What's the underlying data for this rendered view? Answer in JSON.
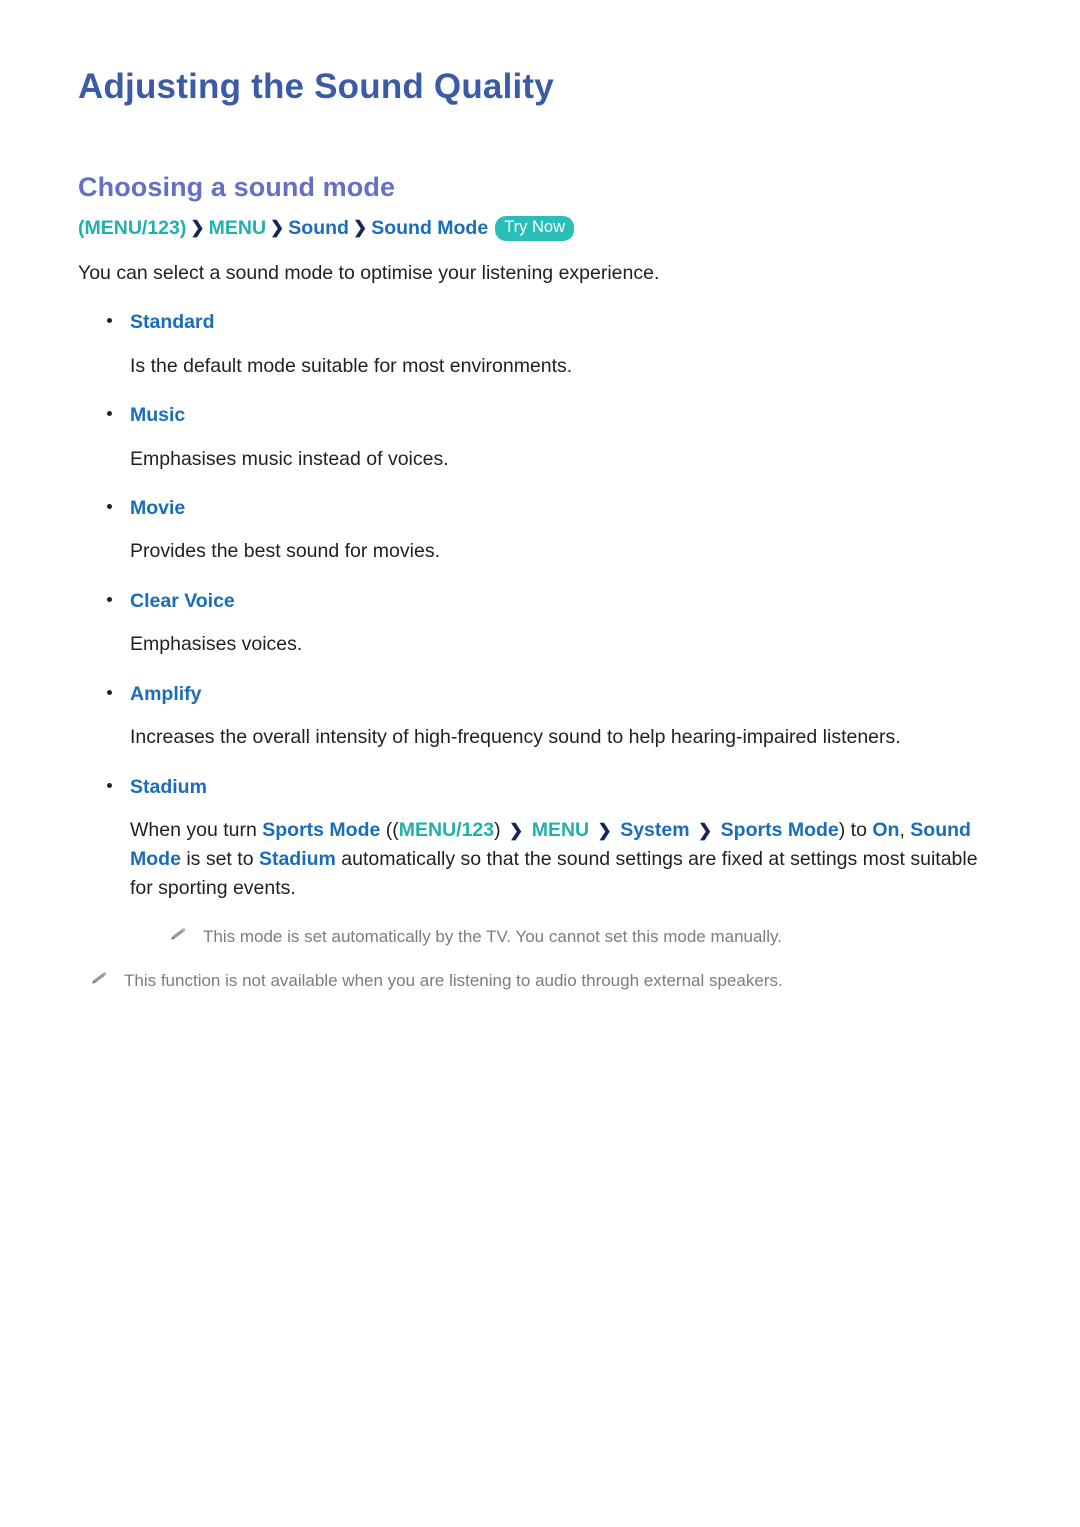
{
  "document": {
    "title": "Adjusting the Sound Quality",
    "section_heading": "Choosing a sound mode"
  },
  "breadcrumb": {
    "open_paren": "(",
    "menu123": "MENU/123",
    "close_paren": ")",
    "arrow": "❯",
    "menu": "MENU",
    "sound": "Sound",
    "sound_mode": "Sound Mode",
    "try_now_badge": "Try Now"
  },
  "intro": "You can select a sound mode to optimise your listening experience.",
  "modes": [
    {
      "label": "Standard",
      "description": "Is the default mode suitable for most environments."
    },
    {
      "label": "Music",
      "description": "Emphasises music instead of voices."
    },
    {
      "label": "Movie",
      "description": "Provides the best sound for movies."
    },
    {
      "label": "Clear Voice",
      "description": "Emphasises voices."
    },
    {
      "label": "Amplify",
      "description": "Increases the overall intensity of high-frequency sound to help hearing-impaired listeners."
    },
    {
      "label": "Stadium",
      "description_parts": {
        "t1": "When you turn ",
        "link1": "Sports Mode",
        "t2": " ((",
        "teal1": "MENU/123",
        "t3": ") ",
        "arrow1": "❯",
        "teal2": " MENU ",
        "arrow2": "❯",
        "link2": " System ",
        "arrow3": "❯",
        "link3": " Sports Mode",
        "t4": ") to ",
        "link4": "On",
        "t5": ", ",
        "link5": "Sound Mode",
        "t6": " is set to ",
        "link6": "Stadium",
        "t7": " automatically so that the sound settings are fixed at settings most suitable for sporting events."
      }
    }
  ],
  "notes": [
    "This mode is set automatically by the TV. You cannot set this mode manually.",
    "This function is not available when you are listening to audio through external speakers."
  ],
  "icons": {
    "pencil": "pencil-icon",
    "bullet": "bullet-dot-icon",
    "arrow": "chevron-right-icon"
  },
  "colors": {
    "title_blue": "#3c5ba6",
    "heading_purple": "#6470c4",
    "link_blue": "#1a6db8",
    "teal": "#22b0ad",
    "badge_teal": "#2bbdb7",
    "arrow_navy": "#15255c",
    "body_text": "#231f20",
    "note_gray": "#7d7d7d"
  }
}
